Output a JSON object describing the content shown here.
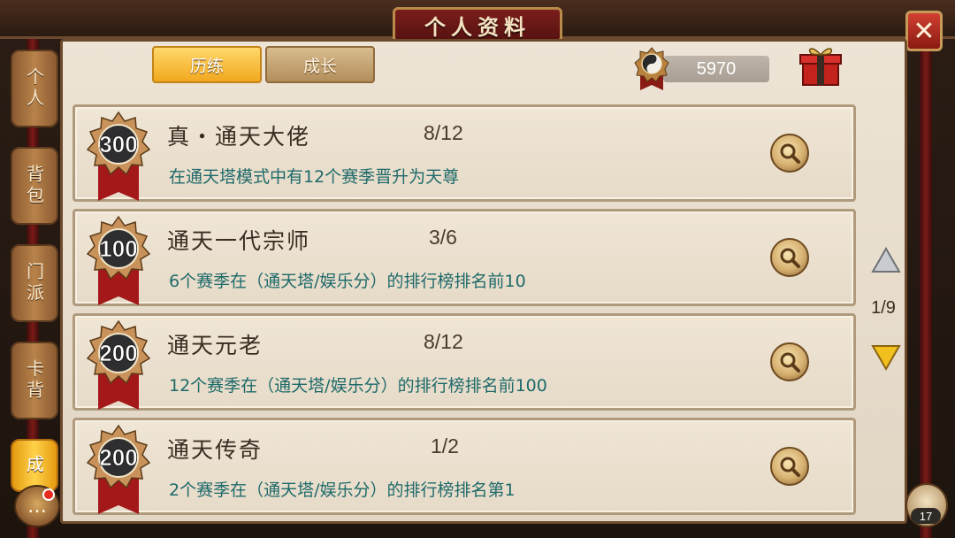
{
  "window": {
    "title": "个人资料",
    "close_icon": "close-x-icon"
  },
  "side_tabs": [
    {
      "label": "个人",
      "active": false
    },
    {
      "label": "背包",
      "active": false
    },
    {
      "label": "门派",
      "active": false
    },
    {
      "label": "卡背",
      "active": false
    },
    {
      "label": "成",
      "active": true
    }
  ],
  "top_tabs": [
    {
      "label": "历练",
      "active": true
    },
    {
      "label": "成长",
      "active": false
    }
  ],
  "header": {
    "points": "5970",
    "points_icon": "yin-yang-badge-icon",
    "gift_icon": "gift-box-icon"
  },
  "achievements": [
    {
      "medal": "300",
      "title": "真・通天大佬",
      "progress": "8/12",
      "desc": "在通天塔模式中有12个赛季晋升为天尊"
    },
    {
      "medal": "100",
      "title": "通天一代宗师",
      "progress": "3/6",
      "desc": "6个赛季在（通天塔/娱乐分）的排行榜排名前10"
    },
    {
      "medal": "200",
      "title": "通天元老",
      "progress": "8/12",
      "desc": "12个赛季在（通天塔/娱乐分）的排行榜排名前100"
    },
    {
      "medal": "200",
      "title": "通天传奇",
      "progress": "1/2",
      "desc": "2个赛季在（通天塔/娱乐分）的排行榜排名第1"
    }
  ],
  "pager": {
    "text": "1/9",
    "up_icon": "triangle-up-icon",
    "down_icon": "triangle-down-icon"
  },
  "footer": {
    "chat_icon": "chat-bubble-icon",
    "friends_icon": "friends-icon",
    "friends_count": "17"
  },
  "colors": {
    "accent_gold": "#f1a81e",
    "title_red": "#7a1e1c",
    "desc_teal": "#1e6a6a",
    "parchment": "#ede4d6"
  }
}
